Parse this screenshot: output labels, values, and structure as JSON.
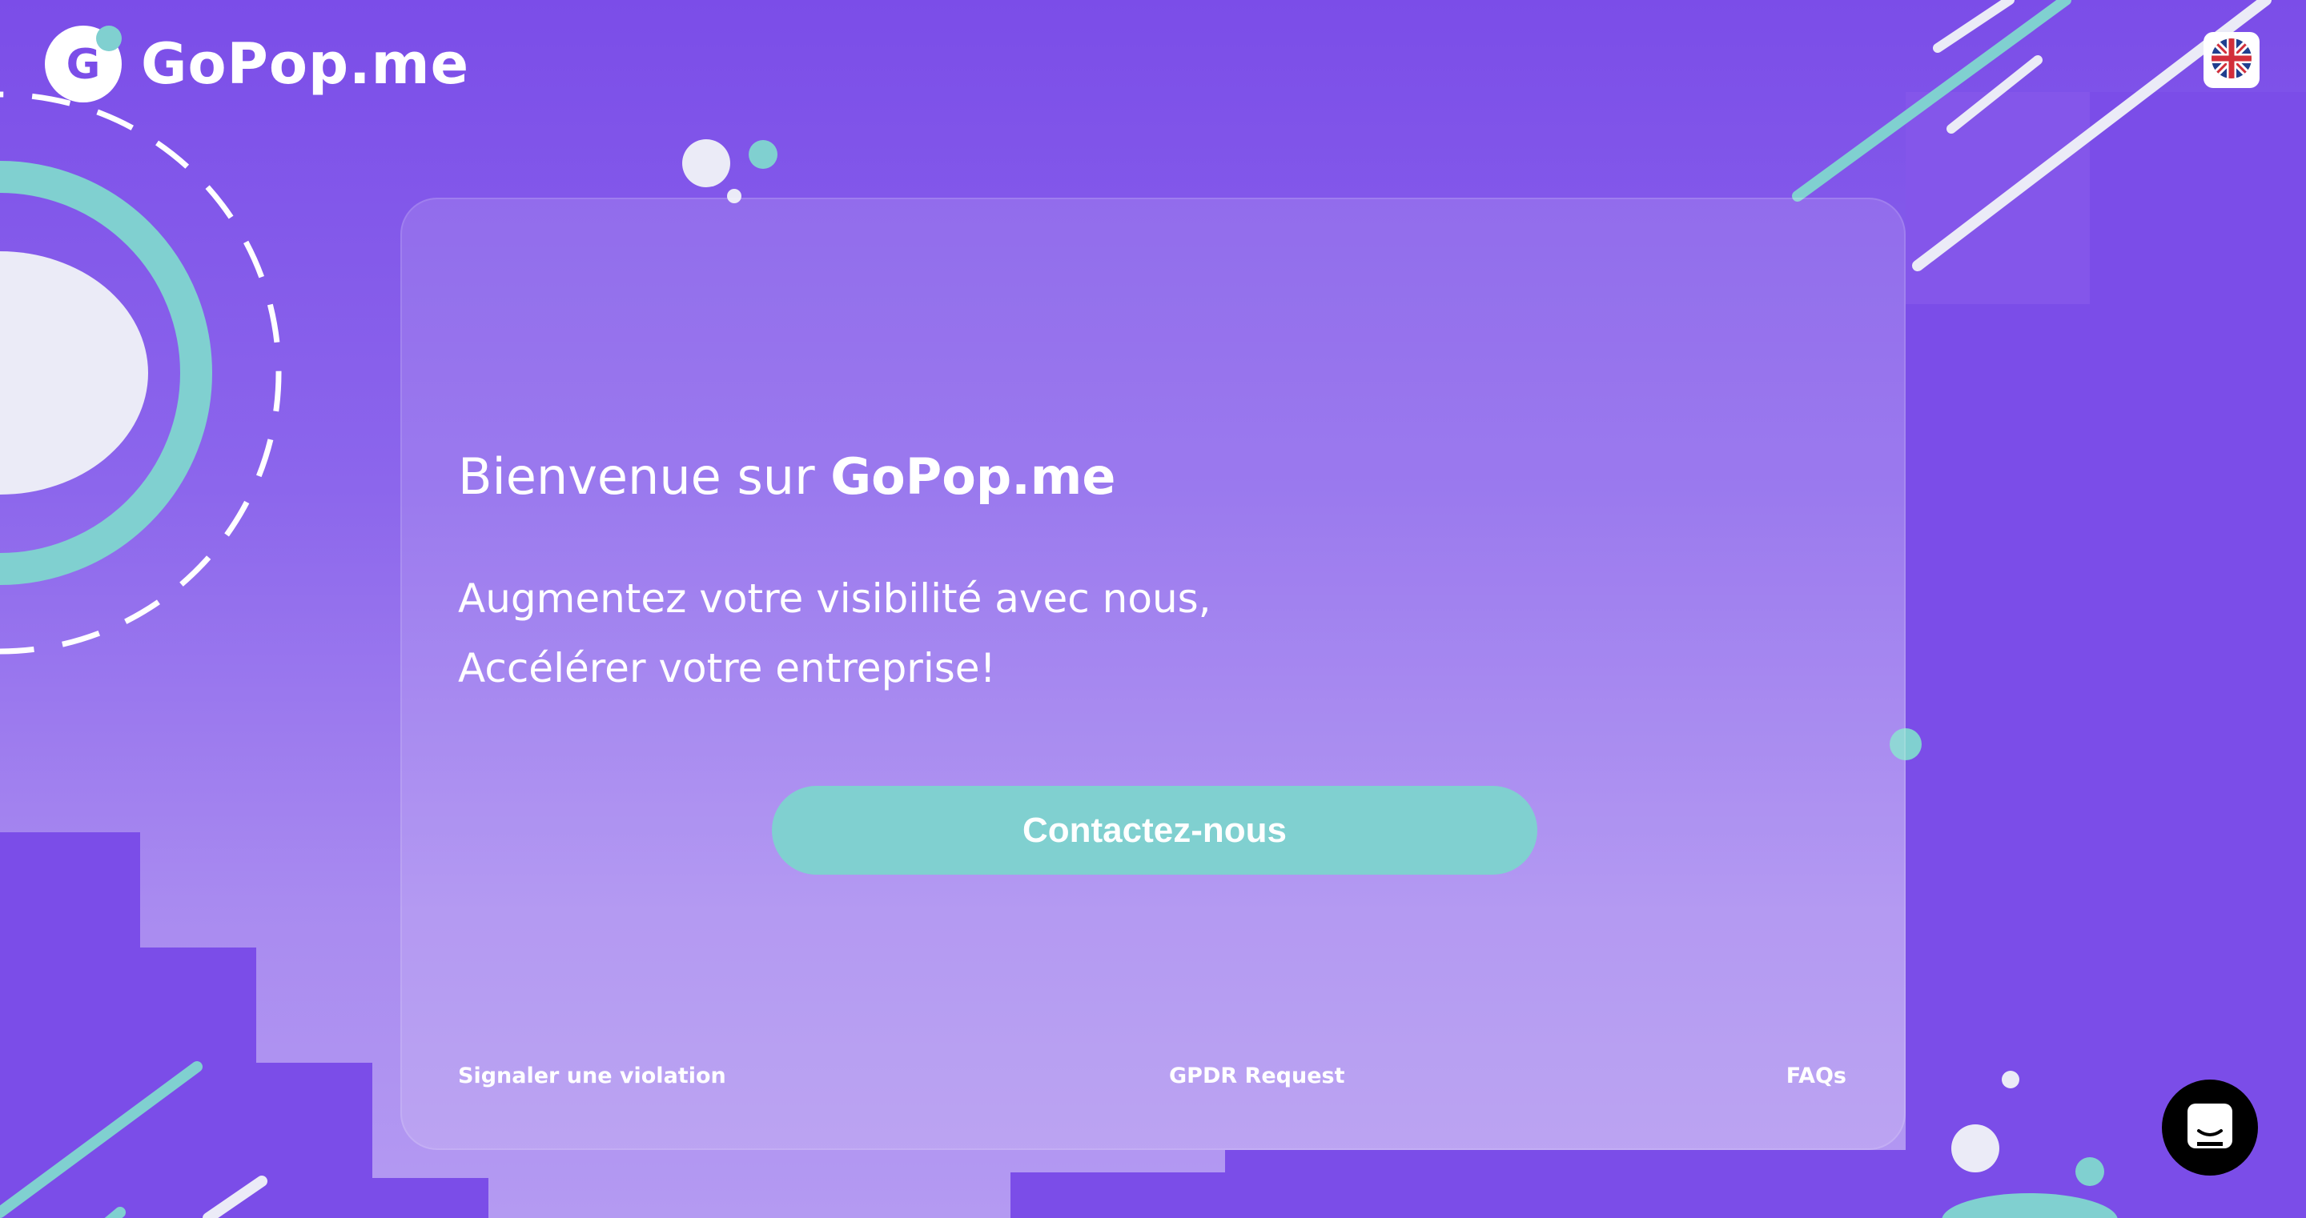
{
  "header": {
    "logo_text": "GoPop.me",
    "language_icon": "uk-flag-icon"
  },
  "card": {
    "title_prefix": "Bienvenue sur",
    "title_brand": "GoPop.me",
    "tagline_line1": "Augmentez votre visibilité avec nous,",
    "tagline_line2": "Accélérer votre entreprise!",
    "cta_label": "Contactez-nous"
  },
  "footer": {
    "report_label": "Signaler une violation",
    "gdpr_label": "GPDR Request",
    "faq_label": "FAQs"
  },
  "chat": {
    "icon": "chat-icon"
  },
  "colors": {
    "background": "#7b4de8",
    "accent": "#80d0d0",
    "text": "#ffffff"
  }
}
